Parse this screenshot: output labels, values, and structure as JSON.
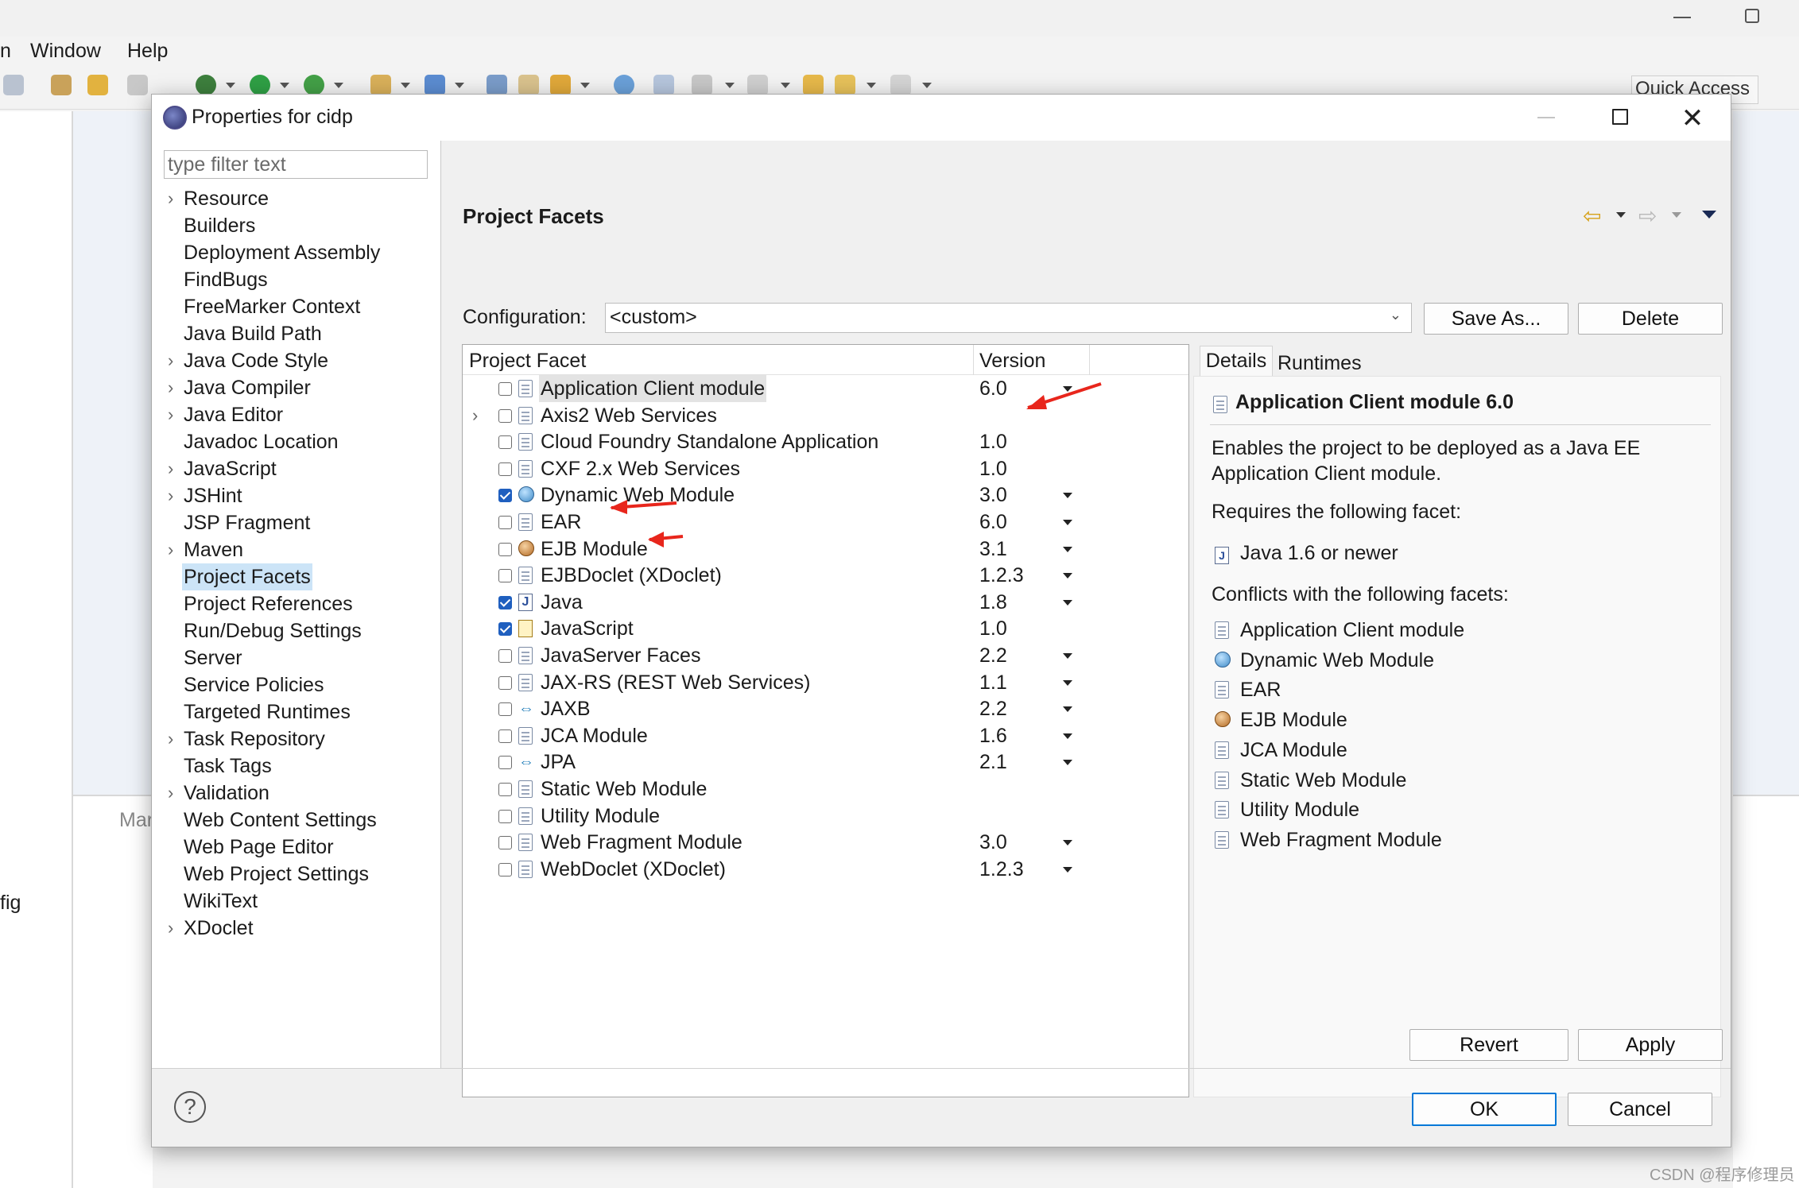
{
  "ide": {
    "menu": [
      "n",
      "Window",
      "Help"
    ],
    "quick_access": "Quick Access",
    "bg_text_left": "fig",
    "bg_text_panel": "Mar",
    "watermark": "CSDN @程序修理员"
  },
  "dialog": {
    "title": "Properties for cidp",
    "close_glyph": "✕"
  },
  "filter": {
    "placeholder": "type filter text"
  },
  "nav": {
    "items": [
      {
        "label": "Resource",
        "expandable": true
      },
      {
        "label": "Builders",
        "expandable": false
      },
      {
        "label": "Deployment Assembly",
        "expandable": false
      },
      {
        "label": "FindBugs",
        "expandable": false
      },
      {
        "label": "FreeMarker Context",
        "expandable": false
      },
      {
        "label": "Java Build Path",
        "expandable": false
      },
      {
        "label": "Java Code Style",
        "expandable": true
      },
      {
        "label": "Java Compiler",
        "expandable": true
      },
      {
        "label": "Java Editor",
        "expandable": true
      },
      {
        "label": "Javadoc Location",
        "expandable": false
      },
      {
        "label": "JavaScript",
        "expandable": true
      },
      {
        "label": "JSHint",
        "expandable": true
      },
      {
        "label": "JSP Fragment",
        "expandable": false
      },
      {
        "label": "Maven",
        "expandable": true
      },
      {
        "label": "Project Facets",
        "expandable": false,
        "selected": true
      },
      {
        "label": "Project References",
        "expandable": false
      },
      {
        "label": "Run/Debug Settings",
        "expandable": false
      },
      {
        "label": "Server",
        "expandable": false
      },
      {
        "label": "Service Policies",
        "expandable": false
      },
      {
        "label": "Targeted Runtimes",
        "expandable": false
      },
      {
        "label": "Task Repository",
        "expandable": true
      },
      {
        "label": "Task Tags",
        "expandable": false
      },
      {
        "label": "Validation",
        "expandable": true
      },
      {
        "label": "Web Content Settings",
        "expandable": false
      },
      {
        "label": "Web Page Editor",
        "expandable": false
      },
      {
        "label": "Web Project Settings",
        "expandable": false
      },
      {
        "label": "WikiText",
        "expandable": false
      },
      {
        "label": "XDoclet",
        "expandable": true
      }
    ]
  },
  "page": {
    "title": "Project Facets",
    "config_label": "Configuration:",
    "config_value": "<custom>",
    "save_as": "Save As...",
    "delete": "Delete",
    "revert": "Revert",
    "apply": "Apply",
    "ok": "OK",
    "cancel": "Cancel"
  },
  "facets": {
    "col_facet": "Project Facet",
    "col_version": "Version",
    "rows": [
      {
        "name": "Application Client module",
        "version": "6.0",
        "checked": false,
        "dropdown": true,
        "icon": "doc-icon",
        "selected": true
      },
      {
        "name": "Axis2 Web Services",
        "version": "",
        "checked": false,
        "dropdown": false,
        "icon": "doc-icon",
        "expander": true
      },
      {
        "name": "Cloud Foundry Standalone Application",
        "version": "1.0",
        "checked": false,
        "dropdown": false,
        "icon": "doc-icon"
      },
      {
        "name": "CXF 2.x Web Services",
        "version": "1.0",
        "checked": false,
        "dropdown": false,
        "icon": "doc-icon"
      },
      {
        "name": "Dynamic Web Module",
        "version": "3.0",
        "checked": true,
        "dropdown": true,
        "icon": "globe-icon"
      },
      {
        "name": "EAR",
        "version": "6.0",
        "checked": false,
        "dropdown": true,
        "icon": "doc-icon"
      },
      {
        "name": "EJB Module",
        "version": "3.1",
        "checked": false,
        "dropdown": true,
        "icon": "ejb-icon"
      },
      {
        "name": "EJBDoclet (XDoclet)",
        "version": "1.2.3",
        "checked": false,
        "dropdown": true,
        "icon": "doc-icon"
      },
      {
        "name": "Java",
        "version": "1.8",
        "checked": true,
        "dropdown": true,
        "icon": "java-icon"
      },
      {
        "name": "JavaScript",
        "version": "1.0",
        "checked": true,
        "dropdown": false,
        "icon": "js-lock-icon"
      },
      {
        "name": "JavaServer Faces",
        "version": "2.2",
        "checked": false,
        "dropdown": true,
        "icon": "doc-icon"
      },
      {
        "name": "JAX-RS (REST Web Services)",
        "version": "1.1",
        "checked": false,
        "dropdown": true,
        "icon": "doc-icon"
      },
      {
        "name": "JAXB",
        "version": "2.2",
        "checked": false,
        "dropdown": true,
        "icon": "xml-binding-icon"
      },
      {
        "name": "JCA Module",
        "version": "1.6",
        "checked": false,
        "dropdown": true,
        "icon": "doc-icon"
      },
      {
        "name": "JPA",
        "version": "2.1",
        "checked": false,
        "dropdown": true,
        "icon": "xml-binding-icon"
      },
      {
        "name": "Static Web Module",
        "version": "",
        "checked": false,
        "dropdown": false,
        "icon": "doc-icon"
      },
      {
        "name": "Utility Module",
        "version": "",
        "checked": false,
        "dropdown": false,
        "icon": "doc-icon"
      },
      {
        "name": "Web Fragment Module",
        "version": "3.0",
        "checked": false,
        "dropdown": true,
        "icon": "doc-icon"
      },
      {
        "name": "WebDoclet (XDoclet)",
        "version": "1.2.3",
        "checked": false,
        "dropdown": true,
        "icon": "doc-icon"
      }
    ]
  },
  "details": {
    "tab_details": "Details",
    "tab_runtimes": "Runtimes",
    "title": "Application Client module 6.0",
    "description": "Enables the project to be deployed as a Java EE Application Client module.",
    "requires_label": "Requires the following facet:",
    "requires_item": "Java 1.6 or newer",
    "conflicts_label": "Conflicts with the following facets:",
    "conflicts": [
      {
        "name": "Application Client module",
        "icon": "doc-icon"
      },
      {
        "name": "Dynamic Web Module",
        "icon": "globe-icon"
      },
      {
        "name": "EAR",
        "icon": "doc-icon"
      },
      {
        "name": "EJB Module",
        "icon": "ejb-icon"
      },
      {
        "name": "JCA Module",
        "icon": "doc-icon"
      },
      {
        "name": "Static Web Module",
        "icon": "doc-icon"
      },
      {
        "name": "Utility Module",
        "icon": "doc-icon"
      },
      {
        "name": "Web Fragment Module",
        "icon": "doc-icon"
      }
    ]
  },
  "colors": {
    "selection": "#cce4f7",
    "check": "#1f5fbf",
    "annotation_arrow": "#e8261c",
    "default_button_border": "#0078d7"
  }
}
